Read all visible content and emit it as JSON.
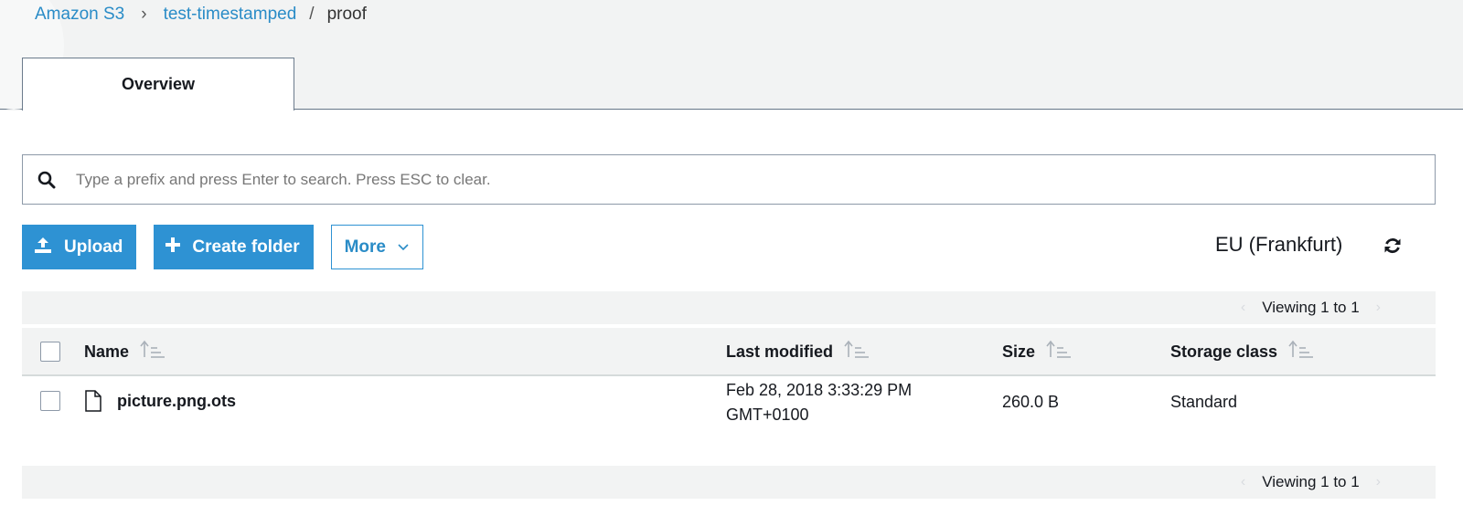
{
  "breadcrumb": {
    "items": [
      "Amazon S3",
      "test-timestamped",
      "proof"
    ]
  },
  "tabs": [
    {
      "label": "Overview"
    }
  ],
  "search": {
    "placeholder": "Type a prefix and press Enter to search. Press ESC to clear."
  },
  "toolbar": {
    "upload_label": "Upload",
    "create_folder_label": "Create folder",
    "more_label": "More"
  },
  "region": "EU (Frankfurt)",
  "pager": {
    "text": "Viewing 1 to 1"
  },
  "table": {
    "columns": [
      "Name",
      "Last modified",
      "Size",
      "Storage class"
    ],
    "rows": [
      {
        "name": "picture.png.ots",
        "last_modified_line1": "Feb 28, 2018 3:33:29 PM",
        "last_modified_line2": "GMT+0100",
        "size": "260.0 B",
        "storage_class": "Standard"
      }
    ]
  },
  "colors": {
    "accent": "#2e92d3",
    "link": "#2a8cc7",
    "header_bg": "#f2f3f3"
  },
  "icons": {
    "search": "search-icon",
    "upload": "upload-icon",
    "create_folder": "plus-icon",
    "more": "chevron-down-icon",
    "refresh": "refresh-icon",
    "sort": "sort-icon",
    "file": "file-icon"
  }
}
